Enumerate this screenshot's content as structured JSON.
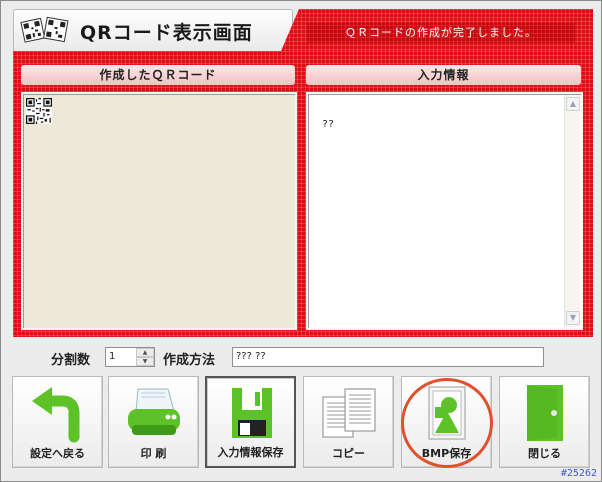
{
  "window": {
    "title": "QRコード表示画面",
    "status_message": "ＱＲコードの作成が完了しました。"
  },
  "panes": {
    "qr_header": "作成したＱＲコード",
    "info_header": "入力情報",
    "info_text": "??"
  },
  "settings": {
    "split_label": "分割数",
    "split_value": "1",
    "method_label": "作成方法",
    "method_value": "???    ??"
  },
  "buttons": {
    "back": "設定へ戻る",
    "print": "印 刷",
    "save_info": "入力情報保存",
    "copy": "コピー",
    "bmp_save": "BMP保存",
    "close": "閉じる"
  },
  "corner_code": "#25262",
  "colors": {
    "accent_red": "#e40a14",
    "highlight_ring": "#e0502c",
    "icon_green": "#5cc227"
  },
  "icons": {
    "app": "qr-code-icon",
    "back": "return-arrow-icon",
    "print": "printer-icon",
    "save_info": "floppy-disk-icon",
    "copy": "copy-pages-icon",
    "bmp": "image-file-icon",
    "close": "door-icon"
  }
}
